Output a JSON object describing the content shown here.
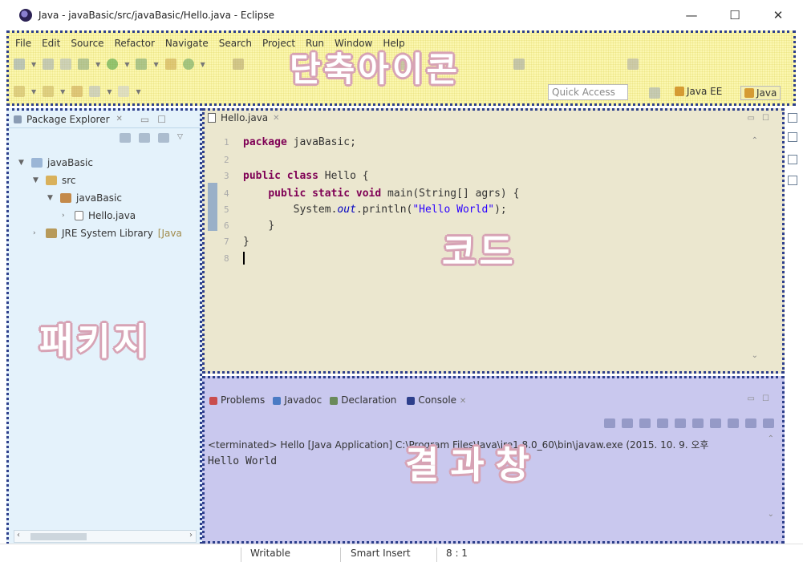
{
  "window": {
    "title": "Java - javaBasic/src/javaBasic/Hello.java - Eclipse",
    "minimize": "—",
    "maximize": "☐",
    "close": "✕"
  },
  "menu": [
    "File",
    "Edit",
    "Source",
    "Refactor",
    "Navigate",
    "Search",
    "Project",
    "Run",
    "Window",
    "Help"
  ],
  "toolbar": {
    "quick_access_placeholder": "Quick Access",
    "perspectives": [
      {
        "label": "Java EE",
        "icon": "java-ee-perspective-icon"
      },
      {
        "label": "Java",
        "icon": "java-perspective-icon",
        "active": true
      }
    ]
  },
  "package_explorer": {
    "title": "Package Explorer",
    "tree": [
      {
        "label": "javaBasic",
        "icon": "project-icon",
        "expanded": true,
        "depth": 0
      },
      {
        "label": "src",
        "icon": "source-folder-icon",
        "expanded": true,
        "depth": 1
      },
      {
        "label": "javaBasic",
        "icon": "package-icon",
        "expanded": true,
        "depth": 2
      },
      {
        "label": "Hello.java",
        "icon": "java-file-icon",
        "expanded": false,
        "depth": 3
      },
      {
        "label": "JRE System Library",
        "suffix": "[Java",
        "icon": "library-icon",
        "expanded": false,
        "depth": 0
      }
    ]
  },
  "editor": {
    "tab_label": "Hello.java",
    "line_numbers": [
      "1",
      "2",
      "3",
      "4",
      "5",
      "6",
      "7",
      "8"
    ],
    "code": {
      "l1_kw": "package",
      "l1_rest": " javaBasic;",
      "l3_kw1": "public",
      "l3_kw2": "class",
      "l3_rest": " Hello {",
      "l4_kws": "public static void",
      "l4_rest": " main(String[] agrs) {",
      "l5_a": "System.",
      "l5_field": "out",
      "l5_b": ".println(",
      "l5_str": "\"Hello World\"",
      "l5_c": ");",
      "l6": "}",
      "l7": "}"
    }
  },
  "console_panel": {
    "tabs": [
      {
        "label": "Problems",
        "icon": "problems-icon",
        "color": "#c94d4d"
      },
      {
        "label": "Javadoc",
        "icon": "javadoc-icon",
        "color": "#4a7bc4"
      },
      {
        "label": "Declaration",
        "icon": "declaration-icon",
        "color": "#6a8a5a"
      },
      {
        "label": "Console",
        "icon": "console-icon",
        "color": "#2d3f8c",
        "active": true
      }
    ],
    "status": "<terminated> Hello [Java Application] C:\\Program Files\\Java\\jre1.8.0_60\\bin\\javaw.exe (2015. 10. 9. 오후",
    "output": "Hello World"
  },
  "overlays": {
    "toolbar": "단축아이콘",
    "package": "패키지",
    "code": "코드",
    "console": "결과창"
  },
  "statusbar": {
    "writable": "Writable",
    "insert_mode": "Smart Insert",
    "position": "8 : 1"
  },
  "colors": {
    "toolbar_zone": "#fbf7b0",
    "package_zone": "#e4f2fb",
    "code_zone": "#ebe7cf",
    "console_zone": "#c9c8ee",
    "zone_border": "#2d3f8c",
    "overlay_outline": "#d7a3b5",
    "keyword": "#7f0055",
    "string": "#2a00ff"
  }
}
